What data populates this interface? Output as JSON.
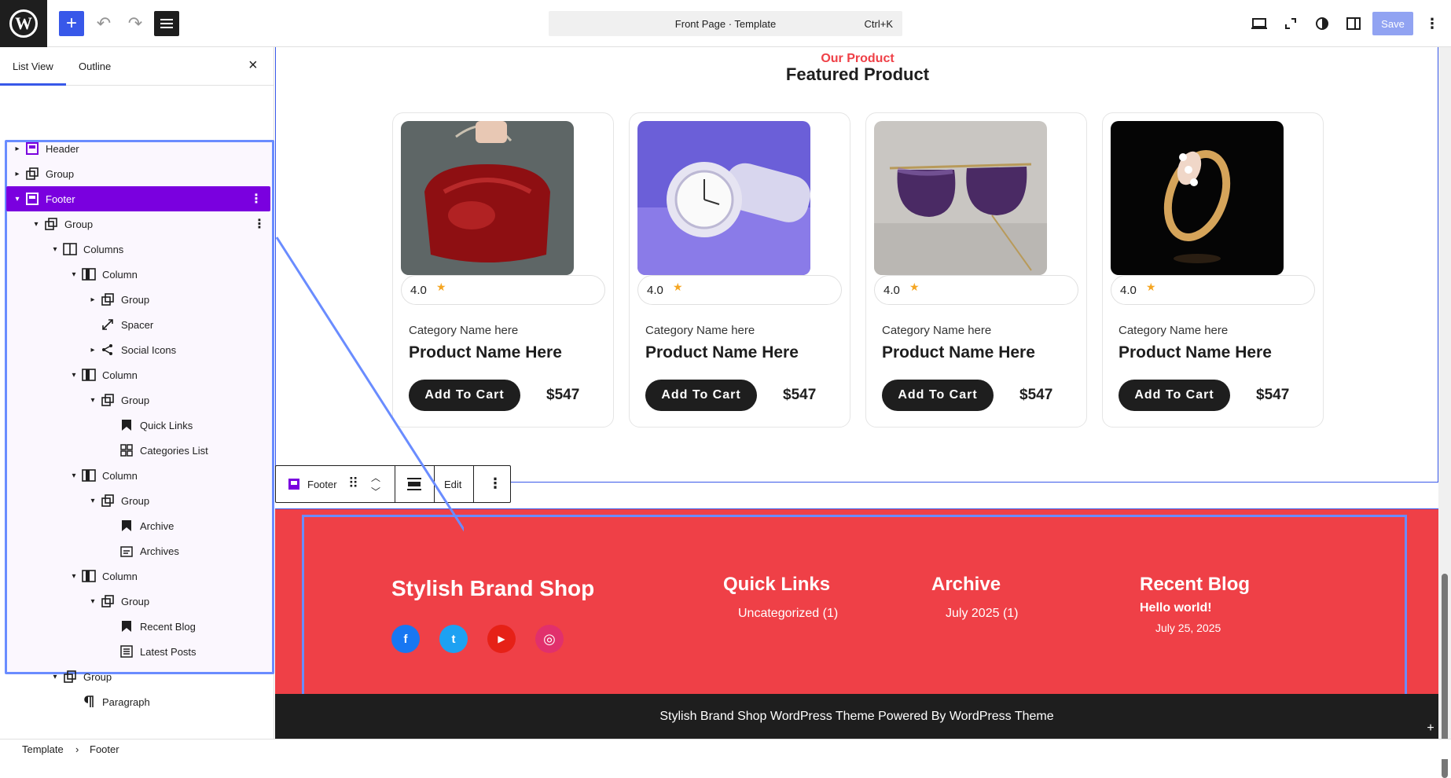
{
  "topbar": {
    "logo": "W",
    "add_icon": "+",
    "undo_icon": "↶",
    "redo_icon": "↷",
    "command": {
      "title": "Front Page · Template",
      "shortcut": "Ctrl+K"
    },
    "save_label": "Save"
  },
  "sidebar": {
    "tabs": [
      "List View",
      "Outline"
    ],
    "close": "×",
    "tree": [
      {
        "label": "Header",
        "icon": "template-part-icon",
        "level": 0,
        "chev": "›"
      },
      {
        "label": "Group",
        "icon": "group-icon",
        "level": 0,
        "chev": "›"
      },
      {
        "label": "Footer",
        "icon": "template-part-icon",
        "level": 0,
        "chev": "⌄",
        "selected": true
      },
      {
        "label": "Group",
        "icon": "group-icon",
        "level": 1,
        "chev": "⌄"
      },
      {
        "label": "Columns",
        "icon": "columns-icon",
        "level": 2,
        "chev": "⌄"
      },
      {
        "label": "Column",
        "icon": "column-icon",
        "level": 3,
        "chev": "⌄"
      },
      {
        "label": "Group",
        "icon": "group-icon",
        "level": 4,
        "chev": "›"
      },
      {
        "label": "Spacer",
        "icon": "spacer-icon",
        "level": 4,
        "chev": ""
      },
      {
        "label": "Social Icons",
        "icon": "share-icon",
        "level": 4,
        "chev": "›"
      },
      {
        "label": "Column",
        "icon": "column-icon",
        "level": 3,
        "chev": "⌄"
      },
      {
        "label": "Group",
        "icon": "group-icon",
        "level": 4,
        "chev": "⌄"
      },
      {
        "label": "Quick Links",
        "icon": "bookmark-icon",
        "level": 5,
        "chev": ""
      },
      {
        "label": "Categories List",
        "icon": "categories-icon",
        "level": 5,
        "chev": ""
      },
      {
        "label": "Column",
        "icon": "column-icon",
        "level": 3,
        "chev": "⌄"
      },
      {
        "label": "Group",
        "icon": "group-icon",
        "level": 4,
        "chev": "⌄"
      },
      {
        "label": "Archive",
        "icon": "bookmark-icon",
        "level": 5,
        "chev": ""
      },
      {
        "label": "Archives",
        "icon": "archive-icon",
        "level": 5,
        "chev": ""
      },
      {
        "label": "Column",
        "icon": "column-icon",
        "level": 3,
        "chev": "⌄"
      },
      {
        "label": "Group",
        "icon": "group-icon",
        "level": 4,
        "chev": "⌄"
      },
      {
        "label": "Recent Blog",
        "icon": "bookmark-icon",
        "level": 5,
        "chev": ""
      },
      {
        "label": "Latest Posts",
        "icon": "post-list-icon",
        "level": 5,
        "chev": ""
      },
      {
        "label": "Group",
        "icon": "group-icon",
        "level": 2,
        "chev": "⌄"
      },
      {
        "label": "Paragraph",
        "icon": "paragraph-icon",
        "level": 3,
        "chev": ""
      }
    ]
  },
  "breadcrumbs": [
    "Template",
    "Footer"
  ],
  "canvas": {
    "eyebrow": "Our Product",
    "title": "Featured Product",
    "products": [
      {
        "rating": "4.0",
        "category": "Category Name here",
        "name": "Product Name Here",
        "cart": "Add To Cart",
        "price": "$547",
        "image": "red-handbag"
      },
      {
        "rating": "4.0",
        "category": "Category Name here",
        "name": "Product Name Here",
        "cart": "Add To Cart",
        "price": "$547",
        "image": "white-watch"
      },
      {
        "rating": "4.0",
        "category": "Category Name here",
        "name": "Product Name Here",
        "cart": "Add To Cart",
        "price": "$547",
        "image": "sunglasses"
      },
      {
        "rating": "4.0",
        "category": "Category Name here",
        "name": "Product Name Here",
        "cart": "Add To Cart",
        "price": "$547",
        "image": "gold-ring"
      }
    ],
    "block_toolbar": {
      "label": "Footer",
      "edit": "Edit"
    },
    "footer": {
      "brand": "Stylish Brand Shop",
      "quick_links_title": "Quick Links",
      "quick_links_item": "Uncategorized (1)",
      "archive_title": "Archive",
      "archive_item": "July 2025 (1)",
      "recent_title": "Recent Blog",
      "recent_post": "Hello world!",
      "recent_date": "July 25, 2025",
      "social": [
        "f",
        "t",
        "▶",
        "◎"
      ],
      "bottom": "Stylish Brand Shop WordPress Theme Powered By WordPress Theme"
    }
  },
  "colors": {
    "accent": "#3858e9",
    "selection": "#7a00df",
    "footer_red": "#ef4047",
    "dark": "#1e1e1e"
  }
}
